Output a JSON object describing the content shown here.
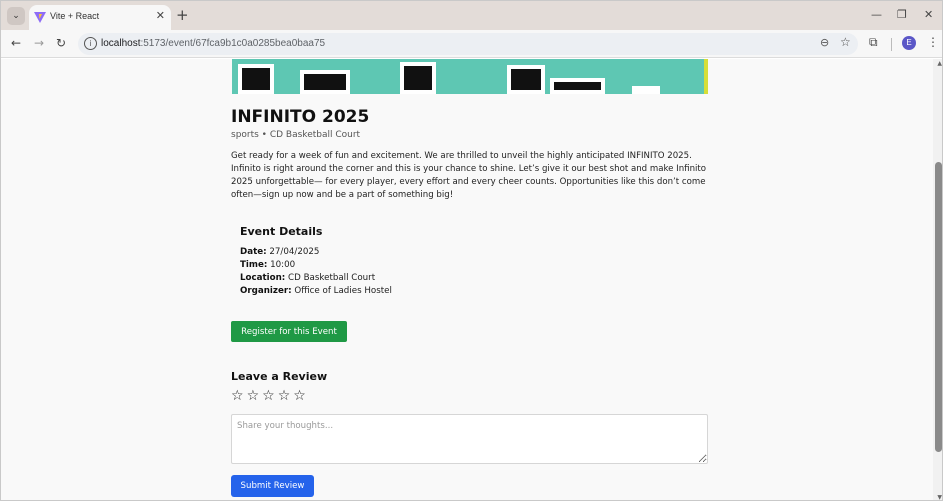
{
  "browser": {
    "tab_title": "Vite + React",
    "url_host": "localhost",
    "url_path": ":5173/event/67fca9b1c0a0285bea0baa75",
    "profile_initial": "E",
    "icons": [
      "tab-search-icon",
      "vite-favicon-icon",
      "close-icon",
      "new-tab-icon",
      "minimize-icon",
      "restore-icon",
      "window-close-icon",
      "back-icon",
      "forward-icon",
      "reload-icon",
      "site-info-icon",
      "zoom-icon",
      "bookmark-star-icon",
      "extensions-icon",
      "menu-icon"
    ]
  },
  "event": {
    "title": "INFINITO 2025",
    "subtitle": "sports • CD Basketball Court",
    "description": "Get ready for a week of fun and excitement. We are thrilled to unveil the highly anticipated INFINITO 2025. Infinito is right around the corner and this is your chance to shine. Let’s give it our best shot and make Infinito 2025 unforgettable— for every player, every effort and every cheer counts. Opportunities like this don’t come often—sign up now and be a part of something big!",
    "details_heading": "Event Details",
    "date_label": "Date:",
    "date_value": "27/04/2025",
    "time_label": "Time:",
    "time_value": "10:00",
    "location_label": "Location:",
    "location_value": "CD Basketball Court",
    "organizer_label": "Organizer:",
    "organizer_value": "Office of Ladies Hostel",
    "register_label": "Register for this Event"
  },
  "review": {
    "heading": "Leave a Review",
    "stars": [
      "☆",
      "☆",
      "☆",
      "☆",
      "☆"
    ],
    "rating": 0,
    "rating_max": 5,
    "placeholder": "Share your thoughts...",
    "value": "",
    "submit_label": "Submit Review"
  },
  "colors": {
    "register_button": "#1f9945",
    "submit_button": "#2563eb",
    "banner": "#5ec7b3"
  }
}
